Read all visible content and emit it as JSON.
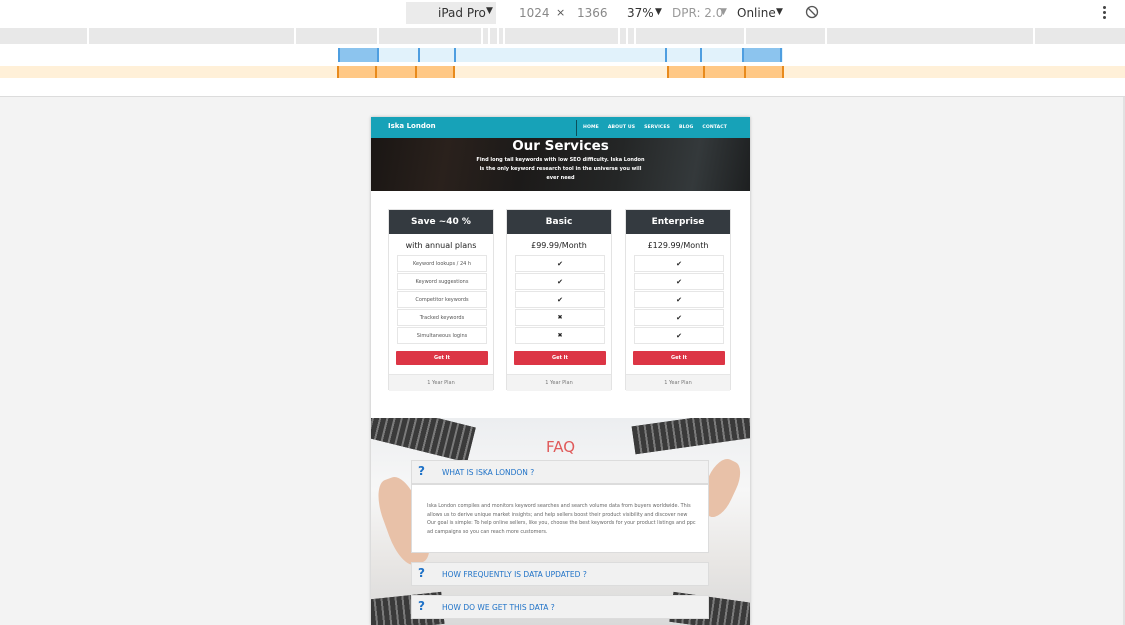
{
  "devtools": {
    "device": "iPad Pro",
    "width": "1024",
    "times": "×",
    "height": "1366",
    "zoom": "37%",
    "dpr": "DPR: 2.0",
    "throttle": "Online",
    "caret": "▼"
  },
  "site": {
    "brand": "Iska London",
    "nav": [
      "HOME",
      "ABOUT US",
      "SERVICES",
      "BLOG",
      "CONTACT"
    ]
  },
  "hero": {
    "title": "Our Services",
    "subtitle": "Find long tail keywords with low SEO difficulty. Iska London is the only keyword research tool in the universe you will ever need"
  },
  "pricing": {
    "cards": [
      {
        "head": "Save ~40 %",
        "price": "with annual plans",
        "rows": [
          "Keyword lookups / 24 h",
          "Keyword suggestions",
          "Competitor keywords",
          "Tracked keywords",
          "Simultaneous logins"
        ],
        "button": "Get It",
        "footer": "1 Year Plan"
      },
      {
        "head": "Basic",
        "price": "£99.99/Month",
        "rows": [
          "✔",
          "✔",
          "✔",
          "✖",
          "✖"
        ],
        "button": "Get It",
        "footer": "1 Year Plan"
      },
      {
        "head": "Enterprise",
        "price": "£129.99/Month",
        "rows": [
          "✔",
          "✔",
          "✔",
          "✔",
          "✔"
        ],
        "button": "Get It",
        "footer": "1 Year Plan"
      }
    ]
  },
  "faq": {
    "title": "FAQ",
    "icon": "?",
    "q1": "WHAT IS ISKA LONDON ?",
    "a1": "Iska London compiles and monitors keyword searches and search volume data from buyers worldwide. This allows us to derive unique market insights; and help sellers boost their product visibility and discover new Our goal is simple: To help online sellers, like you, choose the best keywords for your product listings and ppc ad campaigns so you can reach more customers.",
    "q2": "HOW FREQUENTLY IS DATA UPDATED ?",
    "q3": "HOW DO WE GET THIS DATA ?"
  },
  "colors": {
    "navbar": "#17a2b8",
    "card_head": "#343a40",
    "button": "#dc3545",
    "faq_link": "#1f72c7"
  }
}
